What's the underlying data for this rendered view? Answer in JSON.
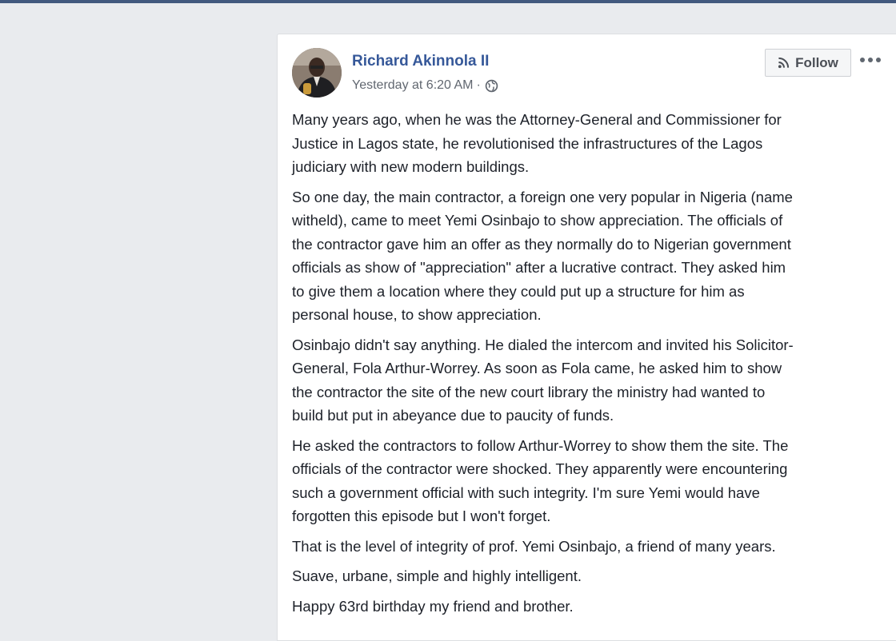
{
  "post": {
    "author": "Richard Akinnola II",
    "timestamp": "Yesterday at 6:20 AM",
    "separator": "·",
    "privacy_icon": "globe-icon",
    "follow_label": "Follow",
    "follow_icon": "rss-icon",
    "more_icon": "more-options-icon",
    "paragraphs": [
      {
        "lines": [
          "Many years ago, when he was the Attorney-General and Commissioner for",
          "Justice in Lagos state, he revolutionised the infrastructures of the Lagos",
          "judiciary with new modern buildings."
        ]
      },
      {
        "lines": [
          "So one day, the main contractor, a foreign one very popular in Nigeria (name",
          "witheld), came to meet Yemi Osinbajo to show appreciation. The officials of",
          "the contractor gave him an offer as they normally do to Nigerian government",
          "officials as show of \"appreciation\" after a lucrative contract. They asked him",
          "to give them a location where they could put up a structure for him as",
          "personal house, to show appreciation."
        ]
      },
      {
        "lines": [
          "Osinbajo didn't say anything. He dialed the intercom and invited his Solicitor-",
          "General, Fola Arthur-Worrey. As soon as Fola came, he asked him to show",
          "the contractor the site of the new court library the ministry had wanted to",
          "build but put in abeyance due to paucity of funds."
        ]
      },
      {
        "lines": [
          "He asked the contractors to follow Arthur-Worrey to show them the site. The",
          "officials of the contractor were shocked. They apparently were encountering",
          "such a government official with such integrity. I'm sure Yemi would have",
          "forgotten this episode but I won't forget."
        ]
      },
      {
        "lines": [
          "That is the level of integrity of prof. Yemi Osinbajo, a friend of many years."
        ]
      },
      {
        "lines": [
          "Suave, urbane, simple and highly intelligent."
        ]
      },
      {
        "lines": [
          "Happy 63rd birthday my friend and brother."
        ]
      }
    ]
  }
}
